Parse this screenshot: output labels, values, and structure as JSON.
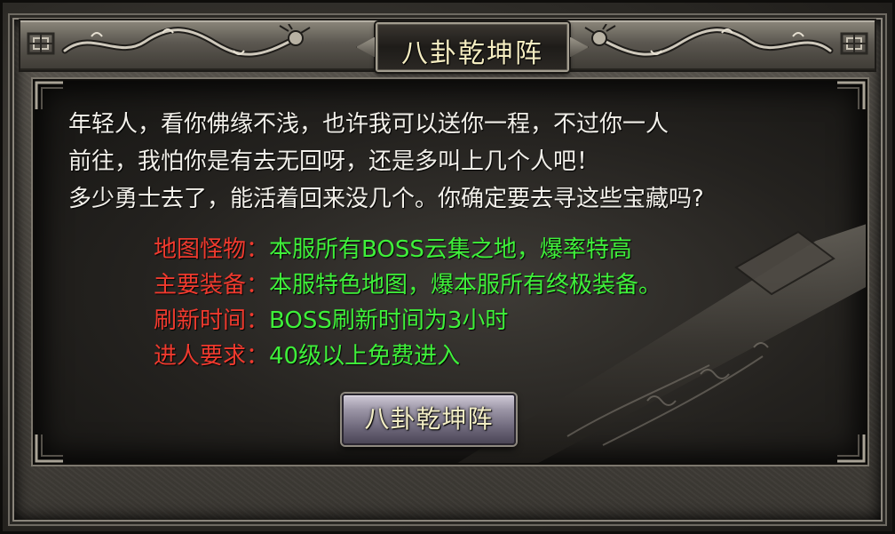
{
  "dialog": {
    "title": "八卦乾坤阵",
    "intro_lines": [
      "年轻人，看你佛缘不浅，也许我可以送你一程，不过你一人",
      "前往，我怕你是有去无回呀，还是多叫上几个人吧！",
      "多少勇士去了，能活着回来没几个。你确定要去寻这些宝藏吗?"
    ],
    "info": [
      {
        "label": "地图怪物：",
        "value": "本服所有BOSS云集之地，爆率特高"
      },
      {
        "label": "主要装备：",
        "value": "本服特色地图，爆本服所有终极装备。"
      },
      {
        "label": "刷新时间：",
        "value": "BOSS刷新时间为3小时"
      },
      {
        "label": "进人要求：",
        "value": "40级以上免费进入"
      }
    ],
    "enter_button_label": "八卦乾坤阵"
  },
  "colors": {
    "label": "#ef3a2e",
    "value": "#3ff03a",
    "intro_text": "#f2f0ea",
    "title_text": "#f4ecc0"
  },
  "icons": {
    "left_ornament": "dragon-ornament-icon",
    "right_ornament": "dragon-ornament-icon",
    "background_art": "sword-icon"
  }
}
